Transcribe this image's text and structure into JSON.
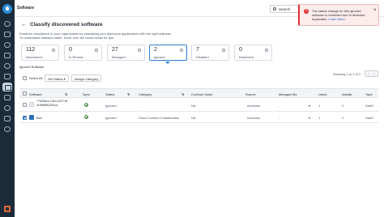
{
  "topbar": {
    "title": "Software",
    "search_label": "Search"
  },
  "header": {
    "title": "Classify discovered software",
    "description_1": "Enhance compliance in your organization by classifying your discovery applications with the right statuses.",
    "description_2": "To understand statuses better, hover over the cards below for tips."
  },
  "cards": [
    {
      "value": "112",
      "label": "Discovered"
    },
    {
      "value": "0",
      "label": "In Review"
    },
    {
      "value": "27",
      "label": "Managed"
    },
    {
      "value": "2",
      "label": "Ignored",
      "selected": true
    },
    {
      "value": "7",
      "label": "Disabled"
    },
    {
      "value": "0",
      "label": "Restricted"
    }
  ],
  "section_title": "Ignored Software",
  "toolbar": {
    "select_all": "Select All",
    "set_status": "Set Status",
    "assign_category": "Assign Category",
    "paging": "Showing 1 to 2 of 2"
  },
  "table": {
    "columns": [
      "Software",
      "Sync",
      "Status",
      "Category",
      "Contract Value",
      "Source",
      "Managed By",
      "Users",
      "Installs",
      "Type"
    ],
    "rows": [
      {
        "software": "77d096cc-13b4-4317-8f4f-f6f6f6f1253ca",
        "status": "Ignored",
        "category": "-",
        "contract_value": "NA",
        "source": "Accessio",
        "managed_by": "-",
        "users": "1",
        "installs": "0",
        "type": "SaaS",
        "checked": false
      },
      {
        "software": "Box",
        "status": "Ignored",
        "category": "Cloud Content Collaboration",
        "contract_value": "NA",
        "source": "Accessio",
        "managed_by": "-",
        "users": "1",
        "installs": "0",
        "type": "SaaS",
        "checked": true
      }
    ]
  },
  "toast": {
    "message": "The status change for this ignored software is restricted due to detected duplicates.",
    "link": "Learn More."
  },
  "colors": {
    "accent": "#2d7fd0",
    "rail": "#1b2b3a",
    "error": "#dd3333",
    "box_brand": "#2d6fb8"
  }
}
